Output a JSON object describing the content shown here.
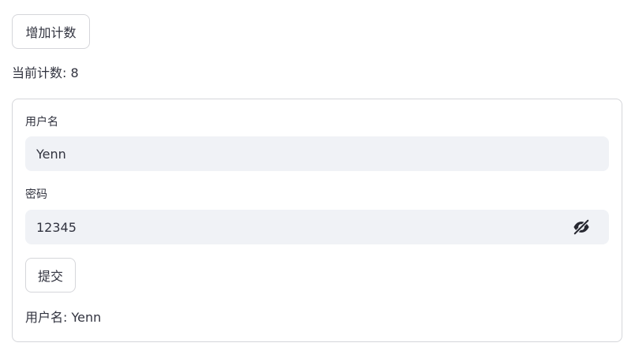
{
  "counter": {
    "button_label": "增加计数",
    "count_label": "当前计数: ",
    "count_value": "8"
  },
  "form": {
    "username_label": "用户名",
    "username_value": "Yenn",
    "password_label": "密码",
    "password_value": "12345",
    "password_toggle_icon": "eye-off-icon",
    "submit_label": "提交",
    "result_label": "用户名: ",
    "result_value": "Yenn"
  }
}
